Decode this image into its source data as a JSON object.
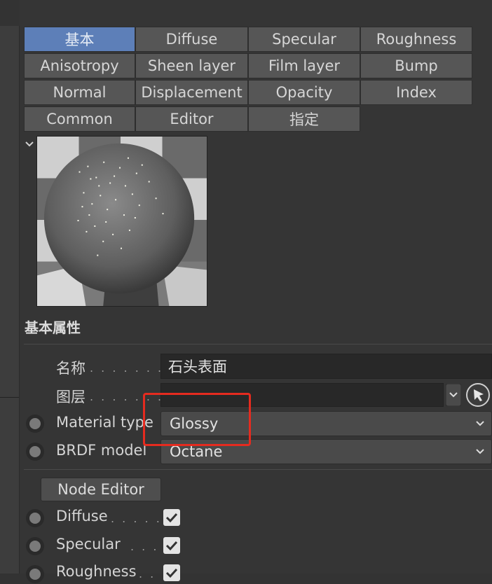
{
  "tabs": [
    {
      "label": "基本",
      "active": true
    },
    {
      "label": "Diffuse"
    },
    {
      "label": "Specular"
    },
    {
      "label": "Roughness"
    },
    {
      "label": "Anisotropy"
    },
    {
      "label": "Sheen layer"
    },
    {
      "label": "Film layer"
    },
    {
      "label": "Bump"
    },
    {
      "label": "Normal"
    },
    {
      "label": "Displacement"
    },
    {
      "label": "Opacity"
    },
    {
      "label": "Index"
    },
    {
      "label": "Common"
    },
    {
      "label": "Editor"
    },
    {
      "label": "指定"
    }
  ],
  "section": {
    "title": "基本属性"
  },
  "fields": {
    "name": {
      "label": "名称",
      "dots": ". . . . . . .",
      "value": "石头表面"
    },
    "layer": {
      "label": "图层",
      "dots": ". . . . . . .",
      "value": ""
    },
    "material_type": {
      "label": "Material type",
      "value": "Glossy"
    },
    "brdf_model": {
      "label": "BRDF model",
      "value": "Octane"
    }
  },
  "node_editor": {
    "label": "Node Editor"
  },
  "channels": [
    {
      "label": "Diffuse",
      "dots": ". . . . .",
      "checked": true
    },
    {
      "label": "Specular",
      "dots": ". . .",
      "checked": true
    },
    {
      "label": "Roughness",
      "dots": ". .",
      "checked": true
    }
  ],
  "colors": {
    "active_tab": "#5d7fb8",
    "highlight": "#e52b1f",
    "checkbox": "#e4e4e4"
  }
}
